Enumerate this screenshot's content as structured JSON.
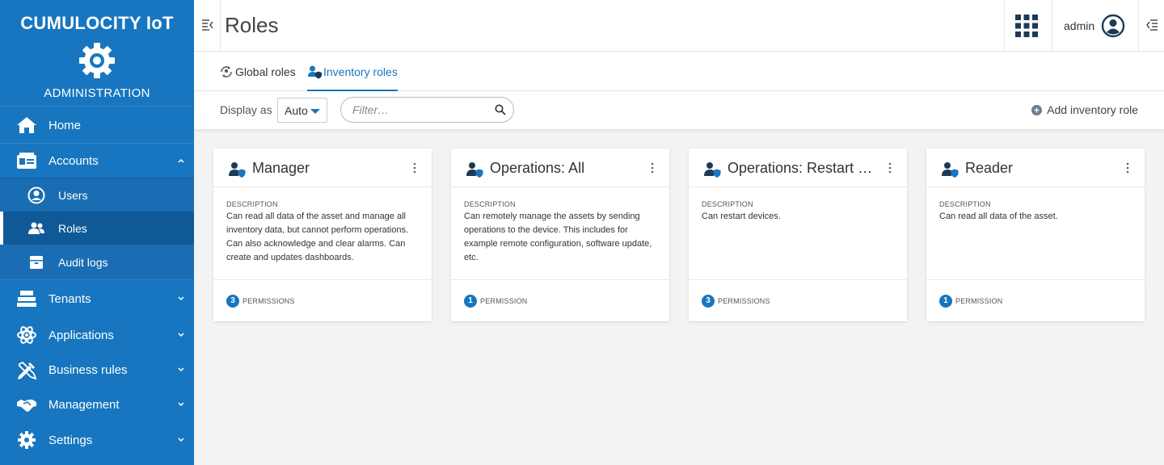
{
  "brand": {
    "title": "CUMULOCITY IoT",
    "subtitle": "ADMINISTRATION"
  },
  "sidebar": {
    "items": [
      {
        "label": "Home",
        "icon": "home-icon"
      },
      {
        "label": "Accounts",
        "icon": "accounts-icon",
        "expanded": true
      },
      {
        "label": "Users",
        "icon": "user-circle-icon"
      },
      {
        "label": "Roles",
        "icon": "users-icon",
        "active": true
      },
      {
        "label": "Audit logs",
        "icon": "archive-icon"
      },
      {
        "label": "Tenants",
        "icon": "tenants-icon"
      },
      {
        "label": "Applications",
        "icon": "atom-icon"
      },
      {
        "label": "Business rules",
        "icon": "tools-icon"
      },
      {
        "label": "Management",
        "icon": "handshake-icon"
      },
      {
        "label": "Settings",
        "icon": "gear-icon"
      }
    ]
  },
  "header": {
    "title": "Roles",
    "user": "admin"
  },
  "tabs": [
    {
      "label": "Global roles",
      "icon": "global-roles-icon"
    },
    {
      "label": "Inventory roles",
      "icon": "inventory-roles-icon",
      "active": true
    }
  ],
  "toolbar": {
    "display_label": "Display as",
    "display_value": "Auto",
    "filter_placeholder": "Filter…",
    "add_label": "Add inventory role"
  },
  "cards": [
    {
      "title": "Manager",
      "description_label": "DESCRIPTION",
      "description": "Can read all data of the asset and manage all inventory data, but cannot perform operations. Can also acknowledge and clear alarms. Can create and updates dashboards.",
      "count": "3",
      "permission_label": "PERMISSIONS"
    },
    {
      "title": "Operations: All",
      "description_label": "DESCRIPTION",
      "description": "Can remotely manage the assets by sending operations to the device. This includes for example remote configuration, software update, etc.",
      "count": "1",
      "permission_label": "PERMISSION"
    },
    {
      "title": "Operations: Restart Device",
      "description_label": "DESCRIPTION",
      "description": "Can restart devices.",
      "count": "3",
      "permission_label": "PERMISSIONS"
    },
    {
      "title": "Reader",
      "description_label": "DESCRIPTION",
      "description": "Can read all data of the asset.",
      "count": "1",
      "permission_label": "PERMISSION"
    }
  ],
  "colors": {
    "primary": "#1776bf",
    "sidebar_active": "#0f5a96",
    "background": "#f2f3f4"
  }
}
